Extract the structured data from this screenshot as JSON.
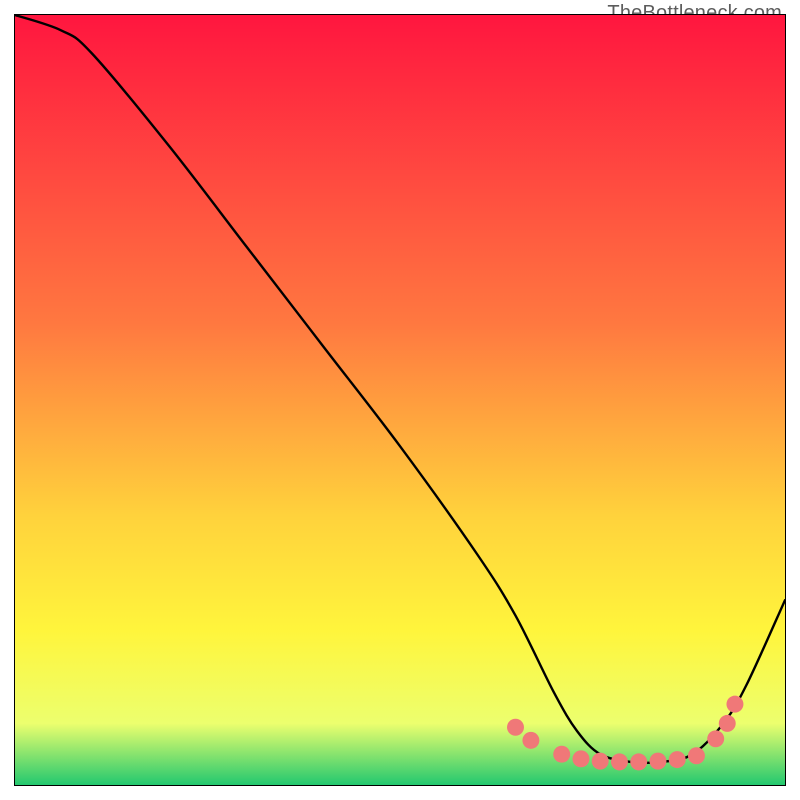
{
  "watermark": "TheBottleneck.com",
  "colors": {
    "top": "#ff163f",
    "mid1": "#ff7840",
    "mid2": "#ffd23c",
    "mid3": "#fff53c",
    "mid4": "#ecff6e",
    "bottom": "#23c86f",
    "curve": "#000000",
    "dot": "#f07878"
  },
  "chart_data": {
    "type": "line",
    "title": "",
    "xlabel": "",
    "ylabel": "",
    "xlim": [
      0,
      100
    ],
    "ylim": [
      0,
      100
    ],
    "series": [
      {
        "name": "bottleneck-curve",
        "x": [
          0,
          6,
          10,
          20,
          30,
          40,
          50,
          60,
          65,
          70,
          73,
          76,
          80,
          84,
          88,
          92,
          95,
          100
        ],
        "values": [
          100,
          98,
          95,
          83,
          70,
          57,
          44,
          30,
          22,
          12,
          7,
          4,
          3,
          3,
          4,
          8,
          13,
          24
        ]
      }
    ],
    "dots": {
      "x": [
        65,
        67,
        71,
        73.5,
        76,
        78.5,
        81,
        83.5,
        86,
        88.5,
        91,
        92.5,
        93.5
      ],
      "values": [
        7.5,
        5.8,
        4.0,
        3.4,
        3.1,
        3.0,
        3.0,
        3.1,
        3.3,
        3.8,
        6.0,
        8.0,
        10.5
      ]
    },
    "gradient_stops": [
      {
        "offset": 0,
        "key": "top"
      },
      {
        "offset": 0.4,
        "key": "mid1"
      },
      {
        "offset": 0.65,
        "key": "mid2"
      },
      {
        "offset": 0.8,
        "key": "mid3"
      },
      {
        "offset": 0.92,
        "key": "mid4"
      },
      {
        "offset": 1.0,
        "key": "bottom"
      }
    ]
  }
}
